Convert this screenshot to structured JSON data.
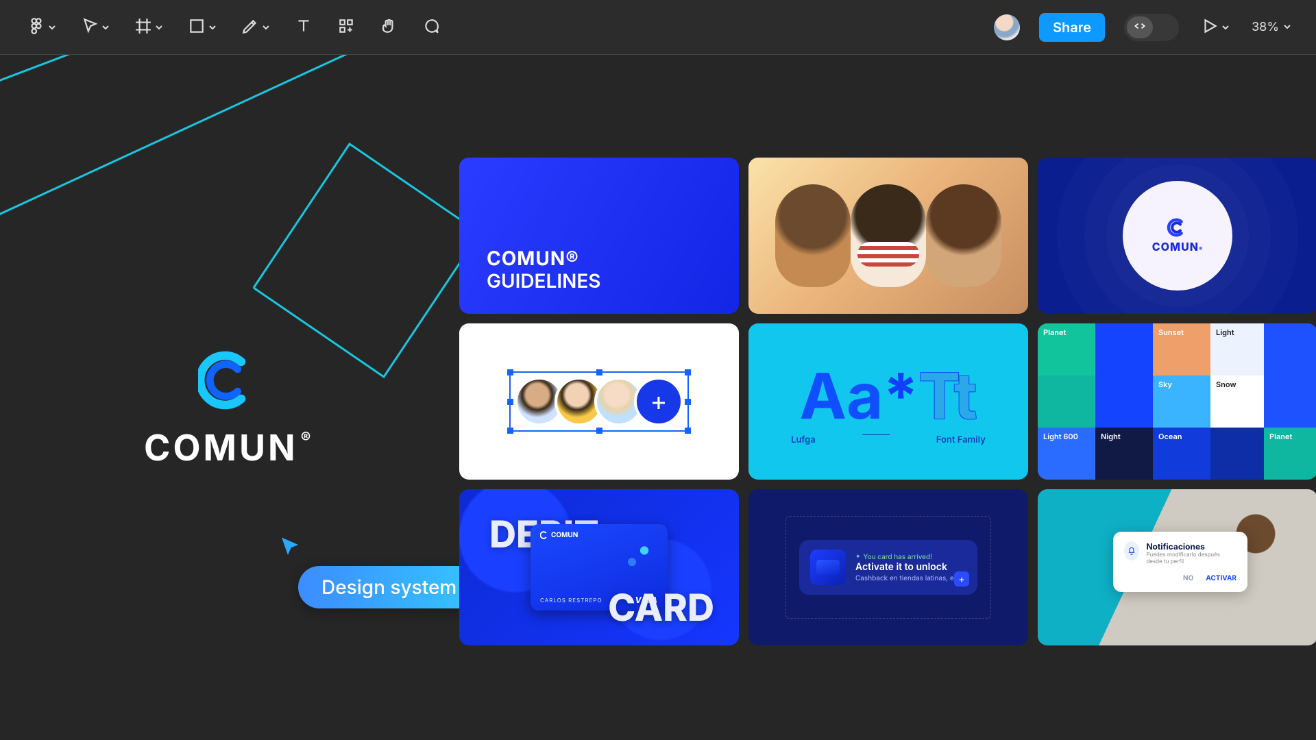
{
  "toolbar": {
    "share_label": "Share",
    "zoom_label": "38%"
  },
  "brand": {
    "name": "COMUN",
    "registered": "®"
  },
  "cursor": {
    "label": "Design system"
  },
  "thumbs": {
    "guidelines": {
      "line1": "COMUN®",
      "line2": "GUIDELINES"
    },
    "logo": {
      "name": "COMUN",
      "registered": "®"
    },
    "avatar_add": "+",
    "typography": {
      "sample_left": "Aa",
      "sample_star": "*",
      "sample_right": "Tt",
      "caption_left": "Lufga",
      "caption_right": "Font Family"
    },
    "palette": {
      "planet": "Planet",
      "sunset": "Sunset",
      "light": "Light",
      "sky": "Sky",
      "snow": "Snow",
      "light600": "Light 600",
      "night": "Night",
      "ocean": "Ocean",
      "planet2": "Planet"
    },
    "card": {
      "word1": "DEBIT",
      "word2": "CARD",
      "brand": "COMUN",
      "holder": "CARLOS RESTREPO",
      "network": "VISA"
    },
    "notif": {
      "banner": "You card has arrived!",
      "title": "Activate it to unlock",
      "subtitle": "Cashback en tiendas latinas, etc...",
      "plus": "+"
    },
    "modal": {
      "title": "Notificaciones",
      "subtitle": "Puedes modificarlo después desde tu perfil",
      "no": "NO",
      "yes": "ACTIVAR"
    }
  }
}
